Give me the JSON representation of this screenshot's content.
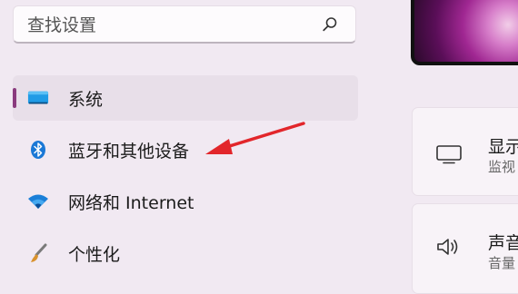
{
  "search": {
    "placeholder": "查找设置",
    "icon": "search-icon"
  },
  "nav": {
    "items": [
      {
        "label": "系统",
        "icon": "display-icon",
        "selected": true
      },
      {
        "label": "蓝牙和其他设备",
        "icon": "bluetooth-icon",
        "selected": false
      },
      {
        "label": "网络和 Internet",
        "icon": "wifi-icon",
        "selected": false
      },
      {
        "label": "个性化",
        "icon": "brush-icon",
        "selected": false
      }
    ]
  },
  "cards": [
    {
      "title": "显示",
      "subtitle": "监视",
      "icon": "monitor-icon"
    },
    {
      "title": "声音",
      "subtitle": "音量",
      "icon": "speaker-icon"
    }
  ],
  "colors": {
    "accent": "#8a3b7e",
    "annotation_arrow": "#e2262b",
    "background": "#f1e9f2"
  }
}
